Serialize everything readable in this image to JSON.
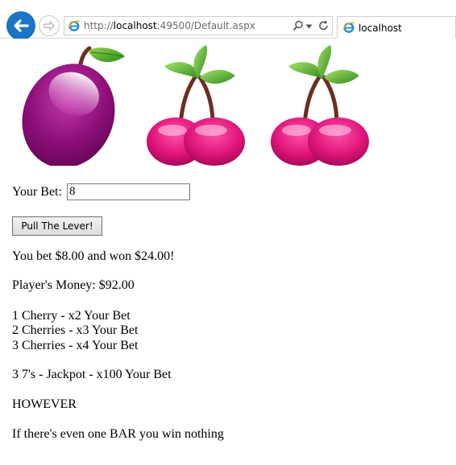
{
  "browser": {
    "url_prefix": "http://",
    "url_host": "localhost",
    "url_rest": ":49500/Default.aspx",
    "tab_title": "localhost",
    "icons": [
      "back-arrow-icon",
      "forward-arrow-icon",
      "ie-icon",
      "search-icon",
      "dropdown-icon",
      "refresh-icon"
    ]
  },
  "slots": {
    "reels": [
      "plum",
      "cherry",
      "cherry"
    ]
  },
  "bet": {
    "label": "Your Bet:",
    "value": "8"
  },
  "button": {
    "label": "Pull The Lever!"
  },
  "result": {
    "message": "You bet $8.00 and won $24.00!",
    "money": "Player's Money: $92.00"
  },
  "rules": {
    "one_cherry": "1 Cherry - x2 Your Bet",
    "two_cherries": "2 Cherries - x3 Your Bet",
    "three_cherries": "3 Cherries - x4 Your Bet",
    "jackpot": "3 7's - Jackpot - x100 Your Bet",
    "however": "HOWEVER",
    "bar_rule": "If there's even one BAR you win nothing"
  },
  "colors": {
    "back_button": "#1b75c6",
    "plum": "#8e0f7a",
    "cherry": "#e0147a",
    "leaf": "#4aa323",
    "stem": "#6b2e1f"
  }
}
